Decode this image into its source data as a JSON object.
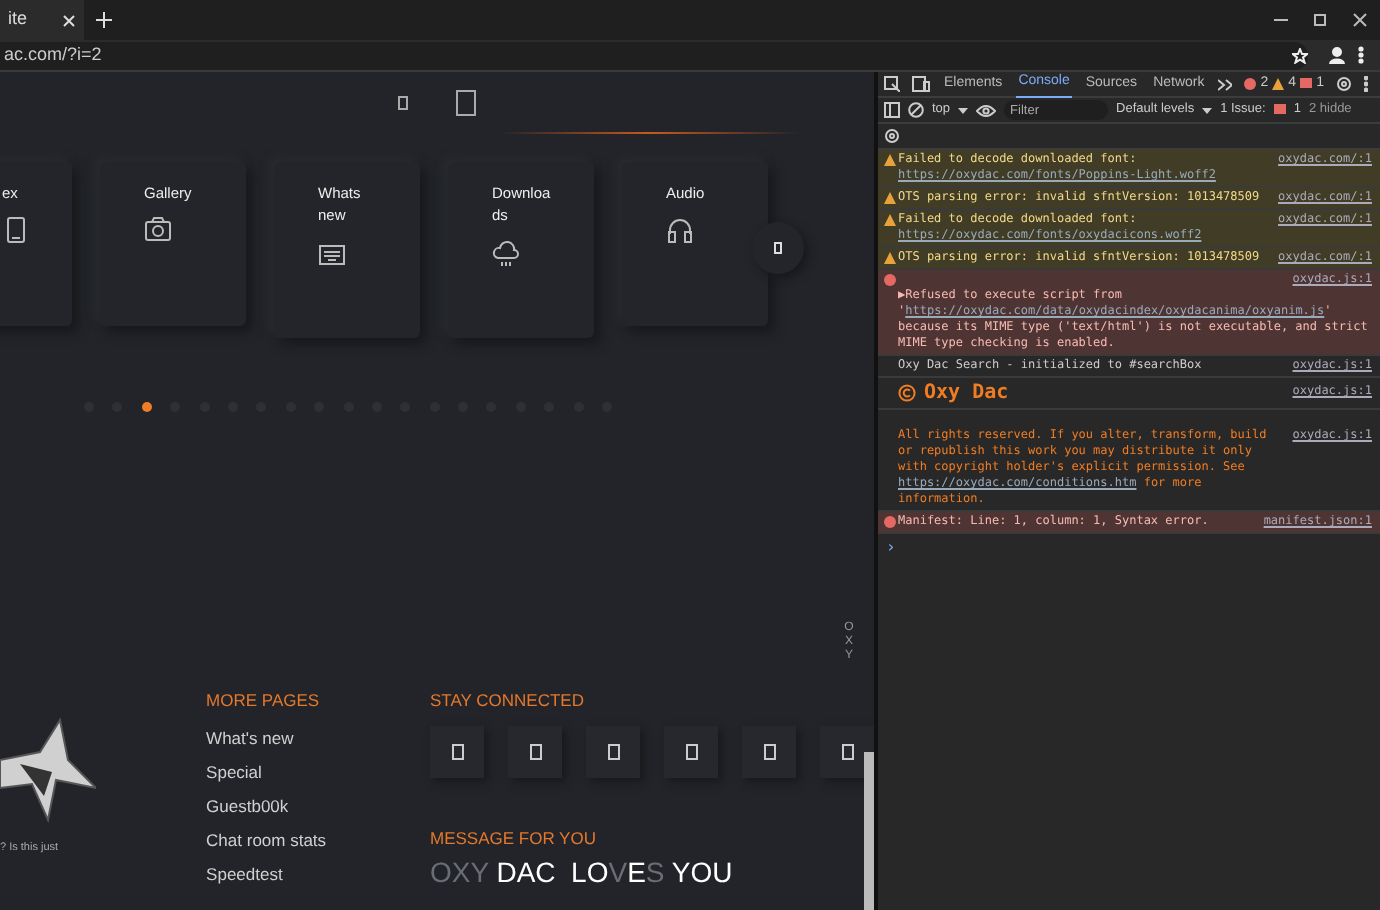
{
  "browser": {
    "tab_title": "ite",
    "address": "ac.com/?i=2"
  },
  "page": {
    "tiles": [
      {
        "label": "ex",
        "kind": "phone"
      },
      {
        "label": "Gallery",
        "kind": "camera"
      },
      {
        "label": "Whats new",
        "kind": "keyboard"
      },
      {
        "label": "Downloa ds",
        "kind": "cloud"
      },
      {
        "label": "Audio",
        "kind": "headphones"
      }
    ],
    "slider_dots": [
      {
        "selected": false
      },
      {
        "selected": false
      },
      {
        "selected": true
      },
      {
        "selected": false
      },
      {
        "selected": false
      },
      {
        "selected": false
      },
      {
        "selected": false
      },
      {
        "selected": false
      },
      {
        "selected": false
      },
      {
        "selected": false
      },
      {
        "selected": false
      },
      {
        "selected": false
      },
      {
        "selected": false
      },
      {
        "selected": false
      },
      {
        "selected": false
      },
      {
        "selected": false
      },
      {
        "selected": false
      },
      {
        "selected": false
      },
      {
        "selected": false
      }
    ],
    "side_letters": [
      "O",
      "X",
      "Y"
    ],
    "footer": {
      "tagline": "? Is this just",
      "more_pages": {
        "title": "MORE PAGES",
        "links": [
          "What's new",
          "Special",
          "Guestb00k",
          "Chat room stats",
          "Speedtest"
        ]
      },
      "stay_connected": {
        "title": "STAY CONNECTED"
      },
      "message": {
        "title": "MESSAGE FOR YOU",
        "segments": [
          {
            "text": "OXY ",
            "dim": true
          },
          {
            "text": "DAC  LO",
            "dim": false
          },
          {
            "text": "V",
            "dim": true
          },
          {
            "text": "E",
            "dim": false
          },
          {
            "text": "S",
            "dim": true
          },
          {
            "text": " YOU",
            "dim": false
          }
        ]
      }
    }
  },
  "devtools": {
    "tabs": [
      {
        "label": "Elements",
        "selected": false
      },
      {
        "label": "Console",
        "selected": true
      },
      {
        "label": "Sources",
        "selected": false
      },
      {
        "label": "Network",
        "selected": false
      }
    ],
    "counts": {
      "errors": "2",
      "warnings": "4",
      "issues": "1"
    },
    "context": "top",
    "filter_placeholder": "Filter",
    "levels": "Default levels",
    "issues_label": "1 Issue:",
    "issues_count": "1",
    "hidden": "2 hidde",
    "messages": [
      {
        "kind": "warning",
        "text": "Failed to decode downloaded font:",
        "url": "https://oxydac.com/fonts/Poppins-Light.woff2",
        "source": "oxydac.com/:1"
      },
      {
        "kind": "warning",
        "text": "OTS parsing error: invalid sfntVersion: 1013478509",
        "source": "oxydac.com/:1"
      },
      {
        "kind": "warning",
        "text": "Failed to decode downloaded font:",
        "url": "https://oxydac.com/fonts/oxydacicons.woff2",
        "source": "oxydac.com/:1"
      },
      {
        "kind": "warning",
        "text": "OTS parsing error: invalid sfntVersion: 1013478509",
        "source": "oxydac.com/:1"
      },
      {
        "kind": "error",
        "text": "▶Refused to execute script from '",
        "url": "https://oxydac.com/data/oxydacindex/oxydacanima/oxyanim.js",
        "after": "' because its MIME type ('text/html') is not executable, and strict MIME type checking is enabled.",
        "source": "oxydac.js:1"
      },
      {
        "kind": "log",
        "text": "Oxy Dac Search - initialized to #searchBox",
        "source": "oxydac.js:1"
      },
      {
        "kind": "banner",
        "text": "Oxy Dac",
        "source": "oxydac.js:1"
      },
      {
        "kind": "notice",
        "text": "All rights reserved. If you alter, transform, build or republish this work you may distribute it only with copyright holder's explicit permission. See",
        "url": "https://oxydac.com/conditions.htm",
        "after": " for more information.",
        "source": "oxydac.js:1"
      },
      {
        "kind": "error",
        "text": "Manifest: Line: 1, column: 1, Syntax error.",
        "source": "manifest.json:1"
      }
    ],
    "prompt": "›"
  }
}
